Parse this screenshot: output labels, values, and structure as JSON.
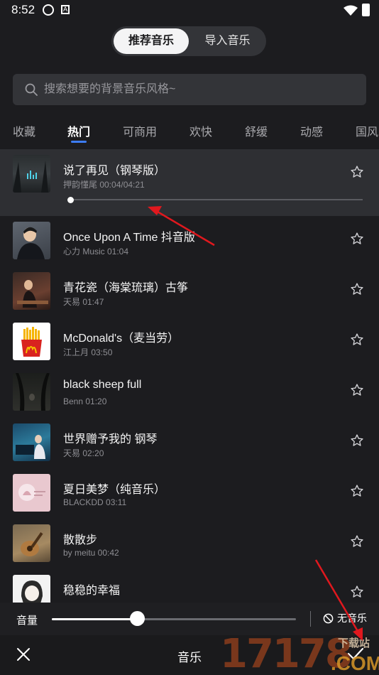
{
  "status_bar": {
    "time": "8:52",
    "icon_b_letter": "A"
  },
  "segment": {
    "active_label": "推荐音乐",
    "inactive_label": "导入音乐"
  },
  "search": {
    "placeholder": "搜索想要的背景音乐风格~"
  },
  "tabs": [
    {
      "label": "收藏"
    },
    {
      "label": "热门"
    },
    {
      "label": "可商用"
    },
    {
      "label": "欢快"
    },
    {
      "label": "舒缓"
    },
    {
      "label": "动感"
    },
    {
      "label": "国风"
    }
  ],
  "active_tab": "热门",
  "songs": [
    {
      "title": "说了再见（钢琴版）",
      "meta": "押韵懂尾 00:04/04:21",
      "playing": true,
      "progress": 0.0
    },
    {
      "title": "Once Upon A Time 抖音版",
      "meta": "心力 Music 01:04"
    },
    {
      "title": "青花瓷（海棠琉璃）古筝",
      "meta": "天易 01:47"
    },
    {
      "title": "McDonald's（麦当劳）",
      "meta": "江上月 03:50"
    },
    {
      "title": "black sheep full",
      "meta": "Benn 01:20"
    },
    {
      "title": "世界赠予我的 钢琴",
      "meta": "天易 02:20"
    },
    {
      "title": "夏日美梦（纯音乐）",
      "meta": "BLACKDD 03:11"
    },
    {
      "title": "散散步",
      "meta": "by meitu 00:42"
    },
    {
      "title": "稳稳的幸福",
      "meta": ""
    }
  ],
  "volume": {
    "label": "音量",
    "level": 0.35
  },
  "no_music": {
    "label": "无音乐"
  },
  "footer": {
    "title": "音乐"
  },
  "watermark": {
    "main": "17178",
    "small": "下载站",
    "com": ".COM"
  },
  "colors": {
    "accent": "#3d7cf5",
    "background": "#1c1c1f",
    "annotation_arrow": "#e0181e"
  }
}
